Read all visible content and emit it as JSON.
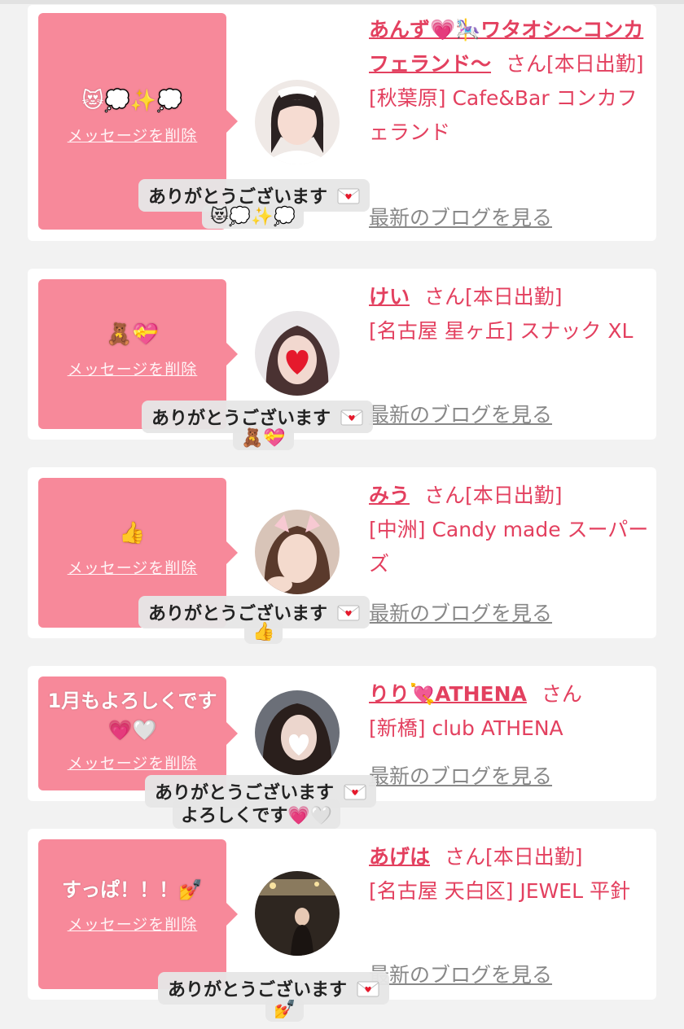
{
  "common": {
    "delete_label": "メッセージを削除",
    "blog_label": "最新のブログを見る",
    "thanks_label": "ありがとうございます"
  },
  "cards": [
    {
      "message": "😻💭✨💭",
      "name": "あんず💗🎠ワタオシ〜コンカフェランド〜",
      "suffix": "さん[本日出勤]",
      "shop": "[秋葉原] Cafe&Bar コンカフェランド",
      "reply": "😻💭✨💭"
    },
    {
      "message": "🧸💝",
      "name": "けい",
      "suffix": "さん[本日出勤]",
      "shop": "[名古屋 星ヶ丘] スナック XL",
      "reply": "🧸💝"
    },
    {
      "message": "👍",
      "name": "みう",
      "suffix": "さん[本日出勤]",
      "shop": "[中洲] Candy made スーパーズ",
      "reply": "👍"
    },
    {
      "message": "1月もよろしくです💗🤍",
      "name": "りり💘ATHENA",
      "suffix": "さん",
      "shop": "[新橋] club ATHENA",
      "reply": "よろしくです💗🤍"
    },
    {
      "message": "すっぱ！！！💅",
      "name": "あげは",
      "suffix": "さん[本日出勤]",
      "shop": "[名古屋 天白区] JEWEL 平針",
      "reply": "💅"
    }
  ]
}
